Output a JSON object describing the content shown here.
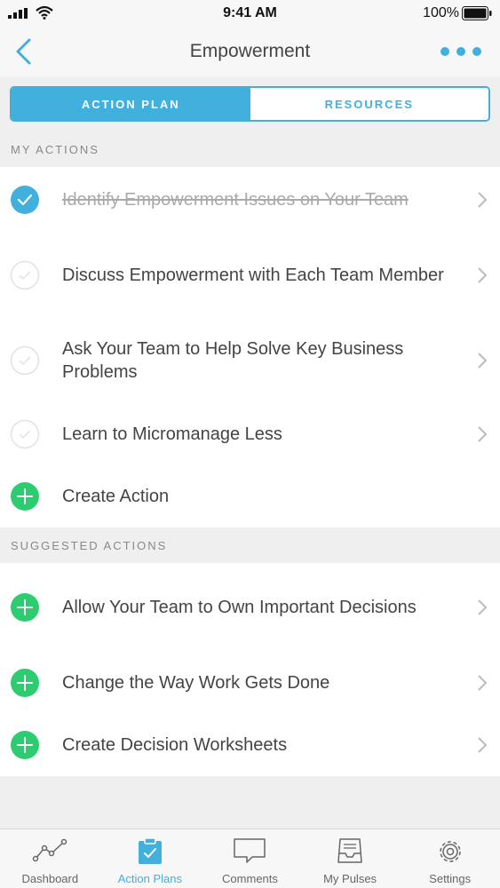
{
  "status_bar": {
    "time": "9:41 AM",
    "battery": "100%"
  },
  "nav": {
    "title": "Empowerment"
  },
  "segments": {
    "action_plan": "ACTION PLAN",
    "resources": "RESOURCES"
  },
  "my_actions": {
    "header": "MY ACTIONS",
    "items": [
      {
        "label": "Identify Empowerment Issues on Your Team",
        "state": "completed"
      },
      {
        "label": "Discuss Empowerment with Each Team Member",
        "state": "pending"
      },
      {
        "label": "Ask Your Team to Help Solve Key Business Problems",
        "state": "pending"
      },
      {
        "label": "Learn to Micromanage Less",
        "state": "pending"
      }
    ],
    "create_label": "Create Action"
  },
  "suggested": {
    "header": "SUGGESTED ACTIONS",
    "items": [
      {
        "label": "Allow Your Team to Own Important Decisions"
      },
      {
        "label": "Change the Way Work Gets Done"
      },
      {
        "label": "Create Decision Worksheets"
      }
    ]
  },
  "tabs": [
    {
      "label": "Dashboard",
      "icon": "chart-line-icon"
    },
    {
      "label": "Action Plans",
      "icon": "clipboard-check-icon",
      "active": true
    },
    {
      "label": "Comments",
      "icon": "speech-bubble-icon"
    },
    {
      "label": "My Pulses",
      "icon": "inbox-tray-icon"
    },
    {
      "label": "Settings",
      "icon": "gear-icon"
    }
  ],
  "colors": {
    "accent": "#41b0dd",
    "add_green": "#2ecc71",
    "strike_gray": "#aaaaaa"
  }
}
